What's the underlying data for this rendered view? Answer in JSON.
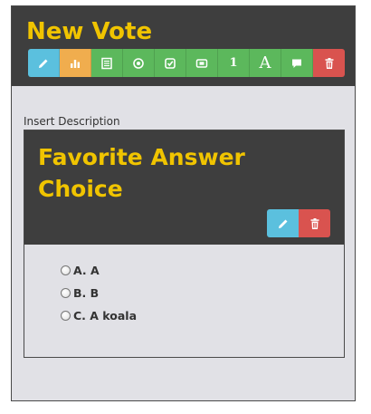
{
  "vote": {
    "title": "New Vote",
    "toolbar": [
      {
        "icon": "pencil-icon",
        "color": "#5bc0de"
      },
      {
        "icon": "bar-chart-icon",
        "color": "#f0ad4e"
      },
      {
        "icon": "list-icon",
        "color": "#5cb85c"
      },
      {
        "icon": "radio-icon",
        "color": "#5cb85c"
      },
      {
        "icon": "checkbox-icon",
        "color": "#5cb85c"
      },
      {
        "icon": "ticket-icon",
        "color": "#5cb85c"
      },
      {
        "icon": "number-icon",
        "color": "#5cb85c",
        "text": "1"
      },
      {
        "icon": "font-icon",
        "color": "#5cb85c",
        "text": "A"
      },
      {
        "icon": "comment-icon",
        "color": "#5cb85c"
      },
      {
        "icon": "trash-icon",
        "color": "#d9534f"
      }
    ]
  },
  "description_label": "Insert Description",
  "question": {
    "title": "Favorite Answer Choice",
    "options": [
      {
        "label": "A. A"
      },
      {
        "label": "B. B"
      },
      {
        "label": "C. A koala"
      }
    ]
  },
  "colors": {
    "header_bg": "#3e3e3e",
    "title_yellow": "#f0c400",
    "panel_bg": "#e1e1e6"
  }
}
